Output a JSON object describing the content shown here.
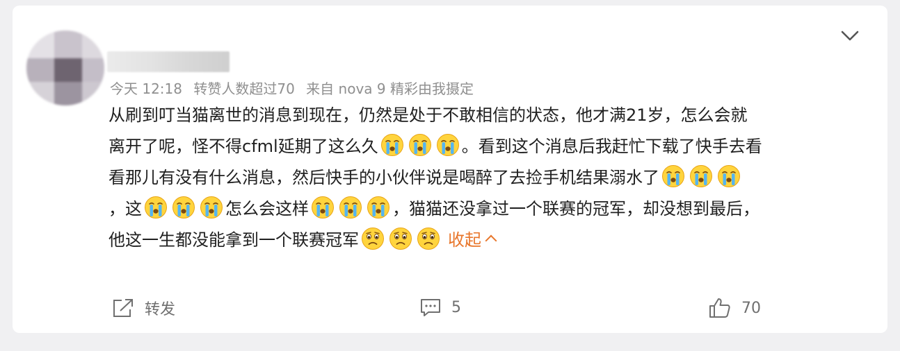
{
  "post": {
    "time": "今天 12:18",
    "tag": "转赞人数超过70",
    "source": "来自 nova 9 精彩由我摄定",
    "lines": [
      "从刷到叮当猫离世的消息到现在，仍然是处于不敢相信的状态，他才满21岁，怎么会就",
      "离开了呢，怪不得cfml延期了这么久",
      "。看到这个消息后我赶忙下载了快手去看",
      "看那儿有没有什么消息，然后快手的小伙伴说是喝醉了去捡手机结果溺水了",
      "，这",
      "怎么会这样",
      "，猫猫还没拿过一个联赛的冠军，却没想到最后，",
      "他这一生都没能拿到一个联赛冠军"
    ],
    "collapse_label": "收起"
  },
  "actions": {
    "repost_label": "转发",
    "comment_count": "5",
    "like_count": "70"
  },
  "icons": {
    "cry_emoji": "crying-face-emoji",
    "sad_emoji": "sad-face-emoji",
    "repost": "share-arrow-icon",
    "comment": "speech-bubble-icon",
    "like": "thumbs-up-icon",
    "menu": "chevron-down-icon"
  },
  "colors": {
    "accent": "#e8762b",
    "meta_text": "#8f8f8f",
    "body_text": "#202020",
    "action_text": "#6f6f6f"
  }
}
